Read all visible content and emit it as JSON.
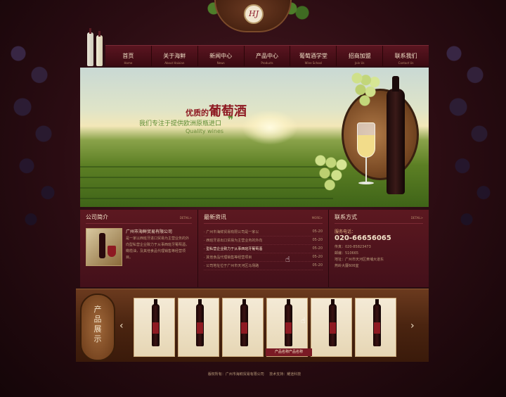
{
  "brand": {
    "logo_text": "HJ"
  },
  "nav": {
    "items": [
      {
        "label": "首页",
        "sub": "Home"
      },
      {
        "label": "关于海鲜",
        "sub": "About Haixian"
      },
      {
        "label": "新闻中心",
        "sub": "News"
      },
      {
        "label": "产品中心",
        "sub": "Products"
      },
      {
        "label": "葡萄酒学堂",
        "sub": "Wine School"
      },
      {
        "label": "招商加盟",
        "sub": "Join Us"
      },
      {
        "label": "联系我们",
        "sub": "Contact Us"
      }
    ]
  },
  "banner": {
    "title_small": "优质的",
    "title_big": "葡萄酒",
    "subtitle": "我们专注于提供欧洲原瓶进口",
    "subtitle_en": "Quality wines",
    "quote": "❞"
  },
  "about": {
    "heading": "公司简介",
    "more": "DETAIL>",
    "company": "广州市海鲜贸易有限公司",
    "text": "是一家以西班牙进口贸易为主营业务的外向型私营企业致力于从事西班牙葡萄酒，橄榄油，及其他食品代理销售等经营项目。"
  },
  "news": {
    "heading": "最新资讯",
    "more": "MORE>",
    "items": [
      {
        "title": "广州市海鲜贸易有限公司是一家以",
        "date": "05-20"
      },
      {
        "title": "西班牙进出口贸易为主营业务的外向",
        "date": "05-20"
      },
      {
        "title": "型私营企业致力于从事西班牙葡萄酒",
        "date": "05-20"
      },
      {
        "title": "其他食品代理销售等经营项目",
        "date": "05-20"
      },
      {
        "title": "公司地址位于广州市天河区马场路",
        "date": "05-20"
      }
    ]
  },
  "contact": {
    "heading": "联系方式",
    "more": "DETAIL>",
    "hotline_label": "服务电话：",
    "hotline": "020-66656065",
    "lines": [
      "传真：020-85823473",
      "邮编：510665",
      "地址：广州市天河区黄埔大道东",
      "燕岭大厦606室"
    ]
  },
  "products": {
    "title": "产品展示",
    "caption": "产品名称产品名称",
    "arrow_left": "‹",
    "arrow_right": "›",
    "count": 6
  },
  "footer": {
    "copyright": "版权所有：广州市海鲜贸易有限公司",
    "support": "技术支持：耀途科技"
  }
}
